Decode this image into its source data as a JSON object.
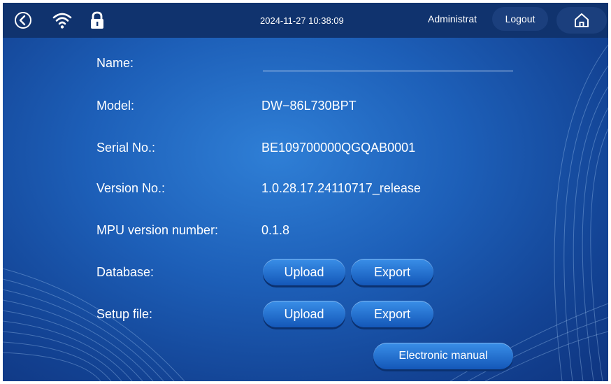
{
  "header": {
    "timestamp": "2024-11-27 10:38:09",
    "user": "Administrat",
    "logout_label": "Logout",
    "icons": [
      "back-icon",
      "wifi-icon",
      "lock-icon",
      "home-icon"
    ]
  },
  "info": {
    "name_label": "Name:",
    "name_value": "",
    "model_label": "Model:",
    "model_value": "DW−86L730BPT",
    "serial_label": "Serial No.:",
    "serial_value": "BE109700000QGQAB0001",
    "version_label": "Version No.:",
    "version_value": "1.0.28.17.24110717_release",
    "mpu_label": "MPU version number:",
    "mpu_value": "0.1.8",
    "database_label": "Database:",
    "setup_label": "Setup file:"
  },
  "buttons": {
    "db_upload": "Upload",
    "db_export": "Export",
    "setup_upload": "Upload",
    "setup_export": "Export",
    "manual": "Electronic manual"
  },
  "colors": {
    "topbar": "#10336e",
    "background": "#1d5fb8",
    "button": "#2a78d8"
  }
}
